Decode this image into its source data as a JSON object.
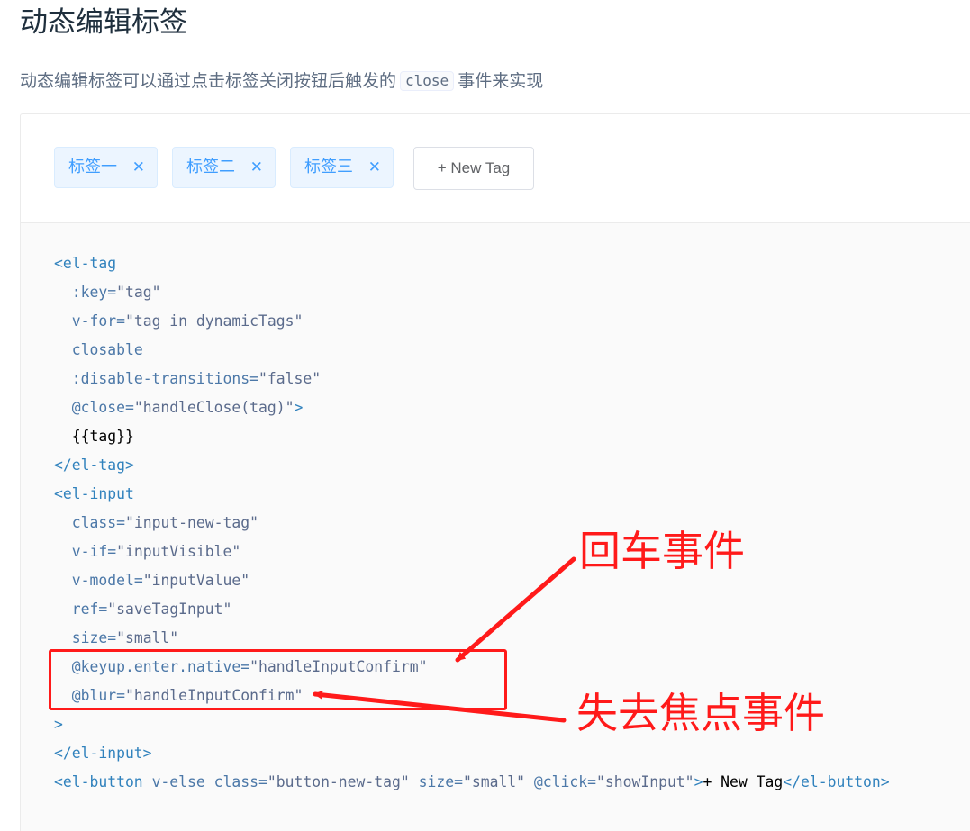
{
  "page": {
    "title": "动态编辑标签",
    "description_before": "动态编辑标签可以通过点击标签关闭按钮后触发的",
    "description_code": "close",
    "description_after": "事件来实现"
  },
  "demo": {
    "tags": [
      {
        "label": "标签一",
        "close_icon": "✕"
      },
      {
        "label": "标签二",
        "close_icon": "✕"
      },
      {
        "label": "标签三",
        "close_icon": "✕"
      }
    ],
    "new_tag_button": "+ New Tag"
  },
  "code": {
    "lines": [
      {
        "indent": "",
        "parts": [
          {
            "t": "tag",
            "v": "<el-tag"
          }
        ]
      },
      {
        "indent": "  ",
        "parts": [
          {
            "t": "attr",
            "v": ":key="
          },
          {
            "t": "str",
            "v": "\"tag\""
          }
        ]
      },
      {
        "indent": "  ",
        "parts": [
          {
            "t": "attr",
            "v": "v-for="
          },
          {
            "t": "str",
            "v": "\"tag in dynamicTags\""
          }
        ]
      },
      {
        "indent": "  ",
        "parts": [
          {
            "t": "attr",
            "v": "closable"
          }
        ]
      },
      {
        "indent": "  ",
        "parts": [
          {
            "t": "attr",
            "v": ":disable-transitions="
          },
          {
            "t": "str",
            "v": "\"false\""
          }
        ]
      },
      {
        "indent": "  ",
        "parts": [
          {
            "t": "attr",
            "v": "@close="
          },
          {
            "t": "str",
            "v": "\"handleClose(tag)\""
          },
          {
            "t": "tag",
            "v": ">"
          }
        ]
      },
      {
        "indent": "  ",
        "parts": [
          {
            "t": "text",
            "v": "{{tag}}"
          }
        ]
      },
      {
        "indent": "",
        "parts": [
          {
            "t": "tag",
            "v": "</el-tag>"
          }
        ]
      },
      {
        "indent": "",
        "parts": [
          {
            "t": "tag",
            "v": "<el-input"
          }
        ]
      },
      {
        "indent": "  ",
        "parts": [
          {
            "t": "attr",
            "v": "class="
          },
          {
            "t": "str",
            "v": "\"input-new-tag\""
          }
        ]
      },
      {
        "indent": "  ",
        "parts": [
          {
            "t": "attr",
            "v": "v-if="
          },
          {
            "t": "str",
            "v": "\"inputVisible\""
          }
        ]
      },
      {
        "indent": "  ",
        "parts": [
          {
            "t": "attr",
            "v": "v-model="
          },
          {
            "t": "str",
            "v": "\"inputValue\""
          }
        ]
      },
      {
        "indent": "  ",
        "parts": [
          {
            "t": "attr",
            "v": "ref="
          },
          {
            "t": "str",
            "v": "\"saveTagInput\""
          }
        ]
      },
      {
        "indent": "  ",
        "parts": [
          {
            "t": "attr",
            "v": "size="
          },
          {
            "t": "str",
            "v": "\"small\""
          }
        ]
      },
      {
        "indent": "  ",
        "parts": [
          {
            "t": "attr",
            "v": "@keyup.enter.native="
          },
          {
            "t": "str",
            "v": "\"handleInputConfirm\""
          }
        ]
      },
      {
        "indent": "  ",
        "parts": [
          {
            "t": "attr",
            "v": "@blur="
          },
          {
            "t": "str",
            "v": "\"handleInputConfirm\""
          }
        ]
      },
      {
        "indent": "",
        "parts": [
          {
            "t": "tag",
            "v": ">"
          }
        ]
      },
      {
        "indent": "",
        "parts": [
          {
            "t": "tag",
            "v": "</el-input>"
          }
        ]
      },
      {
        "indent": "",
        "parts": [
          {
            "t": "tag",
            "v": "<el-button "
          },
          {
            "t": "attr",
            "v": "v-else class="
          },
          {
            "t": "str",
            "v": "\"button-new-tag\""
          },
          {
            "t": "attr",
            "v": " size="
          },
          {
            "t": "str",
            "v": "\"small\""
          },
          {
            "t": "attr",
            "v": " @click="
          },
          {
            "t": "str",
            "v": "\"showInput\""
          },
          {
            "t": "tag",
            "v": ">"
          },
          {
            "t": "text",
            "v": "+ New Tag"
          },
          {
            "t": "tag",
            "v": "</el-button>"
          }
        ]
      }
    ]
  },
  "annotations": {
    "enter_event": "回车事件",
    "blur_event": "失去焦点事件",
    "color": "#ff1a1a"
  },
  "colors": {
    "tag_text": "#409eff",
    "tag_bg": "#ecf5ff",
    "code_bg": "#fafafa"
  }
}
